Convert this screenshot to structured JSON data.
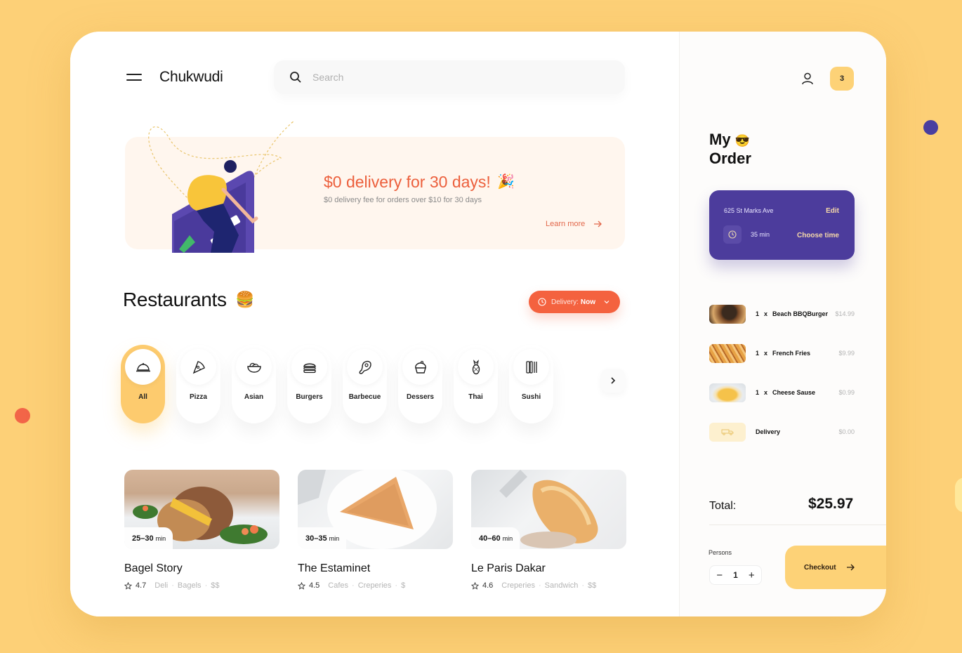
{
  "header": {
    "brand": "Chukwudi",
    "search_placeholder": "Search"
  },
  "promo": {
    "title": "$0 delivery for 30 days!",
    "emoji": "🎉",
    "subtitle": "$0 delivery fee for orders over $10 for 30 days",
    "link": "Learn more"
  },
  "restaurants": {
    "title": "Restaurants",
    "emoji": "🍔",
    "delivery_label": "Delivery:",
    "delivery_value": "Now",
    "categories": [
      {
        "label": "All",
        "icon": "cloche-icon",
        "active": true
      },
      {
        "label": "Pizza",
        "icon": "pizza-icon",
        "active": false
      },
      {
        "label": "Asian",
        "icon": "noodle-bowl-icon",
        "active": false
      },
      {
        "label": "Burgers",
        "icon": "burger-icon",
        "active": false
      },
      {
        "label": "Barbecue",
        "icon": "steak-icon",
        "active": false
      },
      {
        "label": "Dessers",
        "icon": "cupcake-icon",
        "active": false
      },
      {
        "label": "Thai",
        "icon": "pineapple-icon",
        "active": false
      },
      {
        "label": "Sushi",
        "icon": "sushi-chopsticks-icon",
        "active": false
      }
    ],
    "cards": [
      {
        "name": "Bagel Story",
        "time": "25–30",
        "unit": "min",
        "rating": "4.7",
        "tags": [
          "Deli",
          "Bagels",
          "$$"
        ]
      },
      {
        "name": "The Estaminet",
        "time": "30–35",
        "unit": "min",
        "rating": "4.5",
        "tags": [
          "Cafes",
          "Creperies",
          "$"
        ]
      },
      {
        "name": "Le Paris Dakar",
        "time": "40–60",
        "unit": "min",
        "rating": "4.6",
        "tags": [
          "Creperies",
          "Sandwich",
          "$$"
        ]
      }
    ]
  },
  "order": {
    "cart_count": "3",
    "title_line1": "My",
    "title_emoji": "😎",
    "title_line2": "Order",
    "address": "625 St Marks Ave",
    "edit": "Edit",
    "eta": "35 min",
    "choose_time": "Choose time",
    "items": [
      {
        "qty": "1",
        "x": "x",
        "name": "Beach BBQBurger",
        "price": "$14.99"
      },
      {
        "qty": "1",
        "x": "x",
        "name": "French Fries",
        "price": "$9.99"
      },
      {
        "qty": "1",
        "x": "x",
        "name": "Cheese Sause",
        "price": "$0.99"
      }
    ],
    "delivery": {
      "name": "Delivery",
      "price": "$0.00"
    },
    "total_label": "Total:",
    "total_value": "$25.97",
    "persons_label": "Persons",
    "persons_value": "1",
    "minus": "−",
    "plus": "+",
    "checkout": "Checkout"
  },
  "colors": {
    "background": "#fdd077",
    "accent_orange": "#f4623f",
    "accent_purple": "#4c3c9c",
    "accent_yellow": "#fdcb6e"
  }
}
